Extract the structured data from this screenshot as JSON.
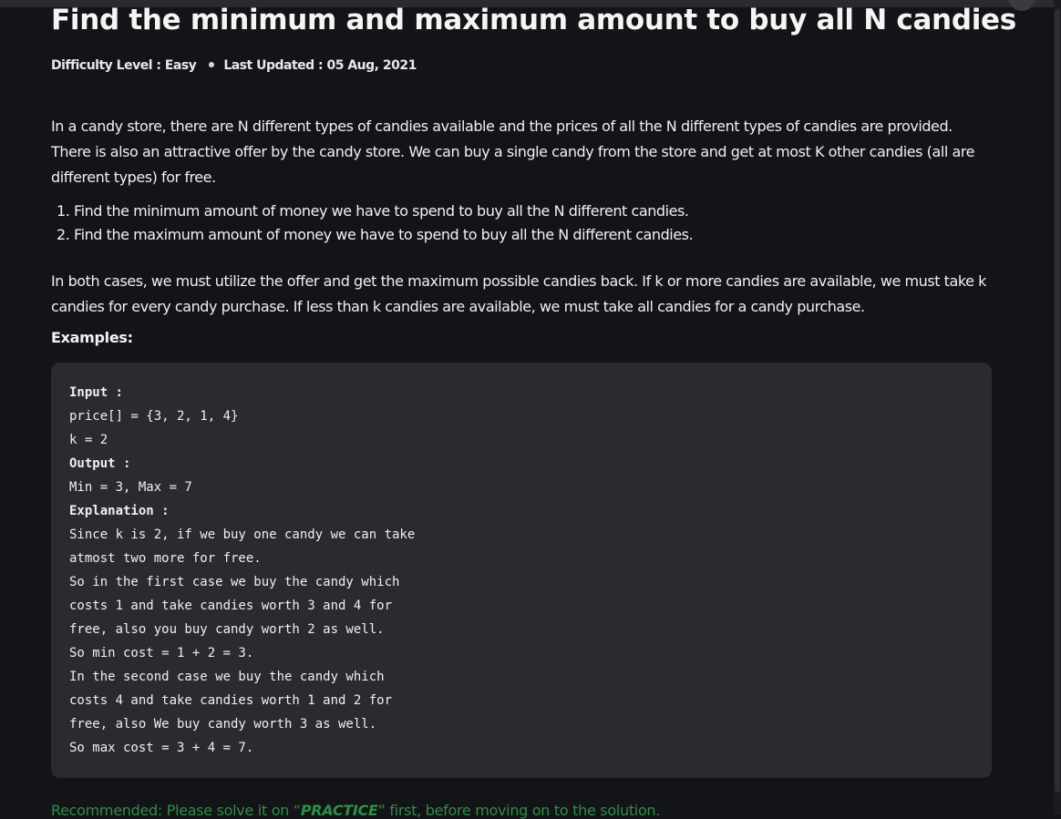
{
  "article": {
    "title": "Find the minimum and maximum amount to buy all N candies",
    "difficulty": "Difficulty Level : Easy",
    "last_updated": "Last Updated : 05 Aug, 2021",
    "intro": "In a candy store, there are N different types of candies available and the prices of all the N different types of candies are provided. There is also an attractive offer by the candy store. We can buy a single candy from the store and get at most K other candies (all are different types) for free.",
    "tasks": [
      "1. Find the minimum amount of money we have to spend to buy all the N different candies.",
      "2. Find the maximum amount of money we have to spend to buy all the N different candies."
    ],
    "rules": "In both cases, we must utilize the offer and get the maximum possible candies back. If k or more candies are available, we must take k candies for every candy purchase. If less than k candies are available, we must take all candies for a candy purchase.",
    "examples_label": "Examples:",
    "example": {
      "input_label": "Input :",
      "input_lines": [
        "price[] = {3, 2, 1, 4}",
        "k = 2"
      ],
      "output_label": "Output :",
      "output_lines": [
        "Min = 3, Max = 7"
      ],
      "explanation_label": "Explanation :",
      "explanation_lines": [
        "Since k is 2, if we buy one candy we can take",
        "atmost two more for free.",
        "So in the first case we buy the candy which",
        "costs 1 and take candies worth 3 and 4 for",
        "free, also you buy candy worth 2 as well.",
        "So min cost = 1 + 2 = 3.",
        "In the second case we buy the candy which",
        "costs 4 and take candies worth 1 and 2 for",
        "free, also We buy candy worth 3 as well.",
        "So max cost = 3 + 4 = 7."
      ]
    },
    "recommend": {
      "prefix": "Recommended: Please solve it on “",
      "practice": "PRACTICE",
      "suffix": "” first, before moving on to the solution."
    }
  }
}
